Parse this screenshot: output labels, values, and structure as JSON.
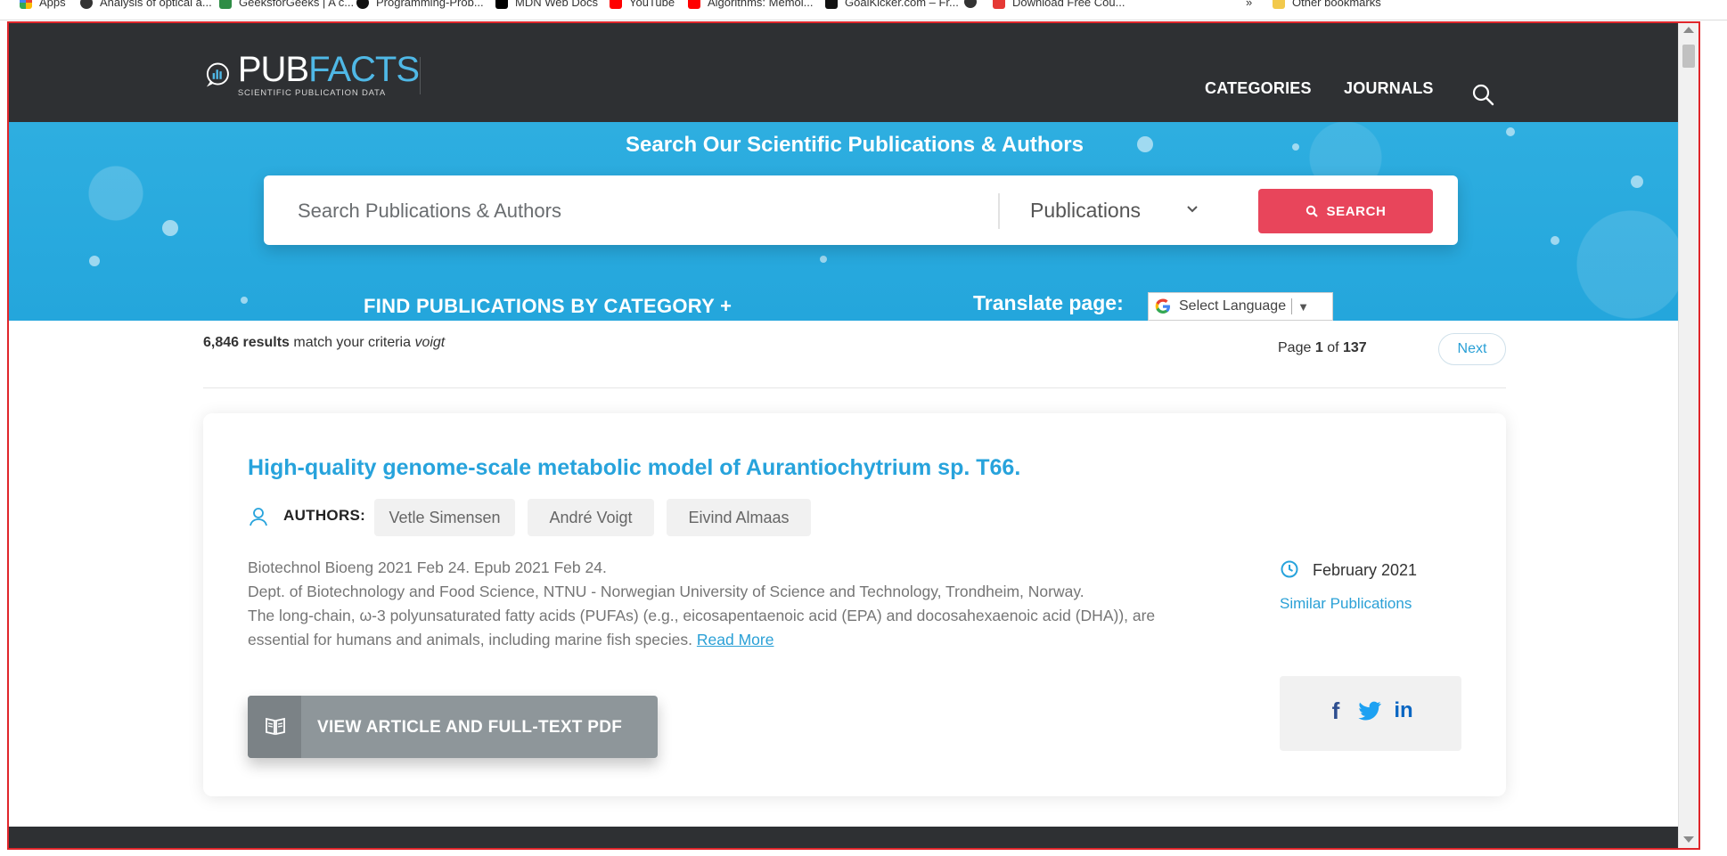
{
  "bookmarks": [
    {
      "label": "Apps",
      "icon": "apps-icon"
    },
    {
      "label": "Analysis of optical a...",
      "icon": "globe-icon"
    },
    {
      "label": "GeeksforGeeks | A c...",
      "icon": "gfg-icon"
    },
    {
      "label": "Programming-Prob...",
      "icon": "github-icon"
    },
    {
      "label": "MDN Web Docs",
      "icon": "mdn-icon"
    },
    {
      "label": "YouTube",
      "icon": "youtube-icon"
    },
    {
      "label": "Algorithms: Memoi...",
      "icon": "youtube-icon"
    },
    {
      "label": "GoalKicker.com – Fr...",
      "icon": "goalkicker-icon"
    },
    {
      "label": "",
      "icon": "globe-icon"
    },
    {
      "label": "Download Free Cou...",
      "icon": "fcu-icon"
    }
  ],
  "bookmarks_overflow": "»",
  "other_bookmarks": "Other bookmarks",
  "logo": {
    "pub": "PUB",
    "facts": "FACTS",
    "tagline": "SCIENTIFIC PUBLICATION DATA"
  },
  "nav": {
    "categories": "CATEGORIES",
    "journals": "JOURNALS"
  },
  "hero": {
    "title": "Search Our Scientific Publications & Authors",
    "search_placeholder": "Search Publications & Authors",
    "search_type": "Publications",
    "search_button": "SEARCH",
    "find_category": "FIND PUBLICATIONS BY CATEGORY +",
    "translate_label": "Translate page:",
    "language_select": "Select Language"
  },
  "results": {
    "count": "6,846 results",
    "criteria_prefix": "match your criteria",
    "query": "voigt",
    "page_label": "Page",
    "page_current": "1",
    "page_of": "of",
    "page_total": "137",
    "next": "Next"
  },
  "article": {
    "title": "High-quality genome-scale metabolic model of Aurantiochytrium sp. T66.",
    "authors_label": "AUTHORS:",
    "authors": [
      "Vetle Simensen",
      "André Voigt",
      "Eivind Almaas"
    ],
    "citation": "Biotechnol Bioeng 2021 Feb 24. Epub 2021 Feb 24.",
    "affiliation": "Dept. of Biotechnology and Food Science, NTNU - Norwegian University of Science and Technology, Trondheim, Norway.",
    "abstract": "The long-chain, ω-3 polyunsaturated fatty acids (PUFAs) (e.g., eicosapentaenoic acid (EPA) and docosahexaenoic acid (DHA)), are essential for humans and animals, including marine fish species.",
    "read_more": "Read More",
    "view_button": "VIEW ARTICLE AND FULL-TEXT PDF",
    "date": "February 2021",
    "similar": "Similar Publications",
    "share": {
      "facebook": "f",
      "twitter": "twitter-icon",
      "linkedin": "in"
    }
  },
  "colors": {
    "header_bg": "#2e3033",
    "hero_bg": "#2eaee0",
    "accent_blue": "#27a3dc",
    "search_button": "#e8455b",
    "view_button": "#8e969a",
    "frame_border": "#e0262b"
  }
}
